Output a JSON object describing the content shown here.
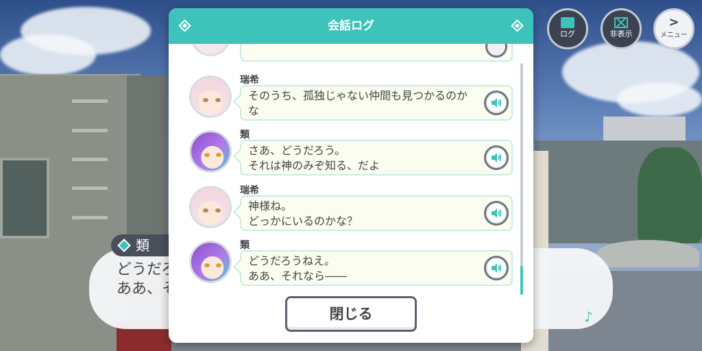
{
  "top_buttons": {
    "log_label": "ログ",
    "hide_label": "非表示",
    "menu_label": "メニュー",
    "menu_glyph": ">"
  },
  "background_dialog": {
    "speaker": "類",
    "text_line1": "どうだろ",
    "text_line2": "ああ、そ"
  },
  "log_modal": {
    "title": "会話ログ",
    "entries": [
      {
        "speaker": "瑞希",
        "line1": "そのうち、孤独じゃない仲間も見つかるのか",
        "line2": "な",
        "avatar": "mizuki"
      },
      {
        "speaker": "類",
        "line1": "さあ、どうだろう。",
        "line2": "それは神のみぞ知る、だよ",
        "avatar": "rui"
      },
      {
        "speaker": "瑞希",
        "line1": "神様ね。",
        "line2": "どっかにいるのかな？",
        "avatar": "mizuki"
      },
      {
        "speaker": "類",
        "line1": "どうだろうねえ。",
        "line2": "ああ、それなら――",
        "avatar": "rui"
      }
    ],
    "close_label": "閉じる"
  },
  "colors": {
    "accent": "#3ec3ba",
    "bubble_bg": "#fbfdf0",
    "text": "#444444"
  },
  "icons": {
    "audio": "speaker-icon",
    "log": "log-icon",
    "hide": "hide-icon",
    "menu": "menu-arrow-icon",
    "music": "music-note-icon"
  }
}
